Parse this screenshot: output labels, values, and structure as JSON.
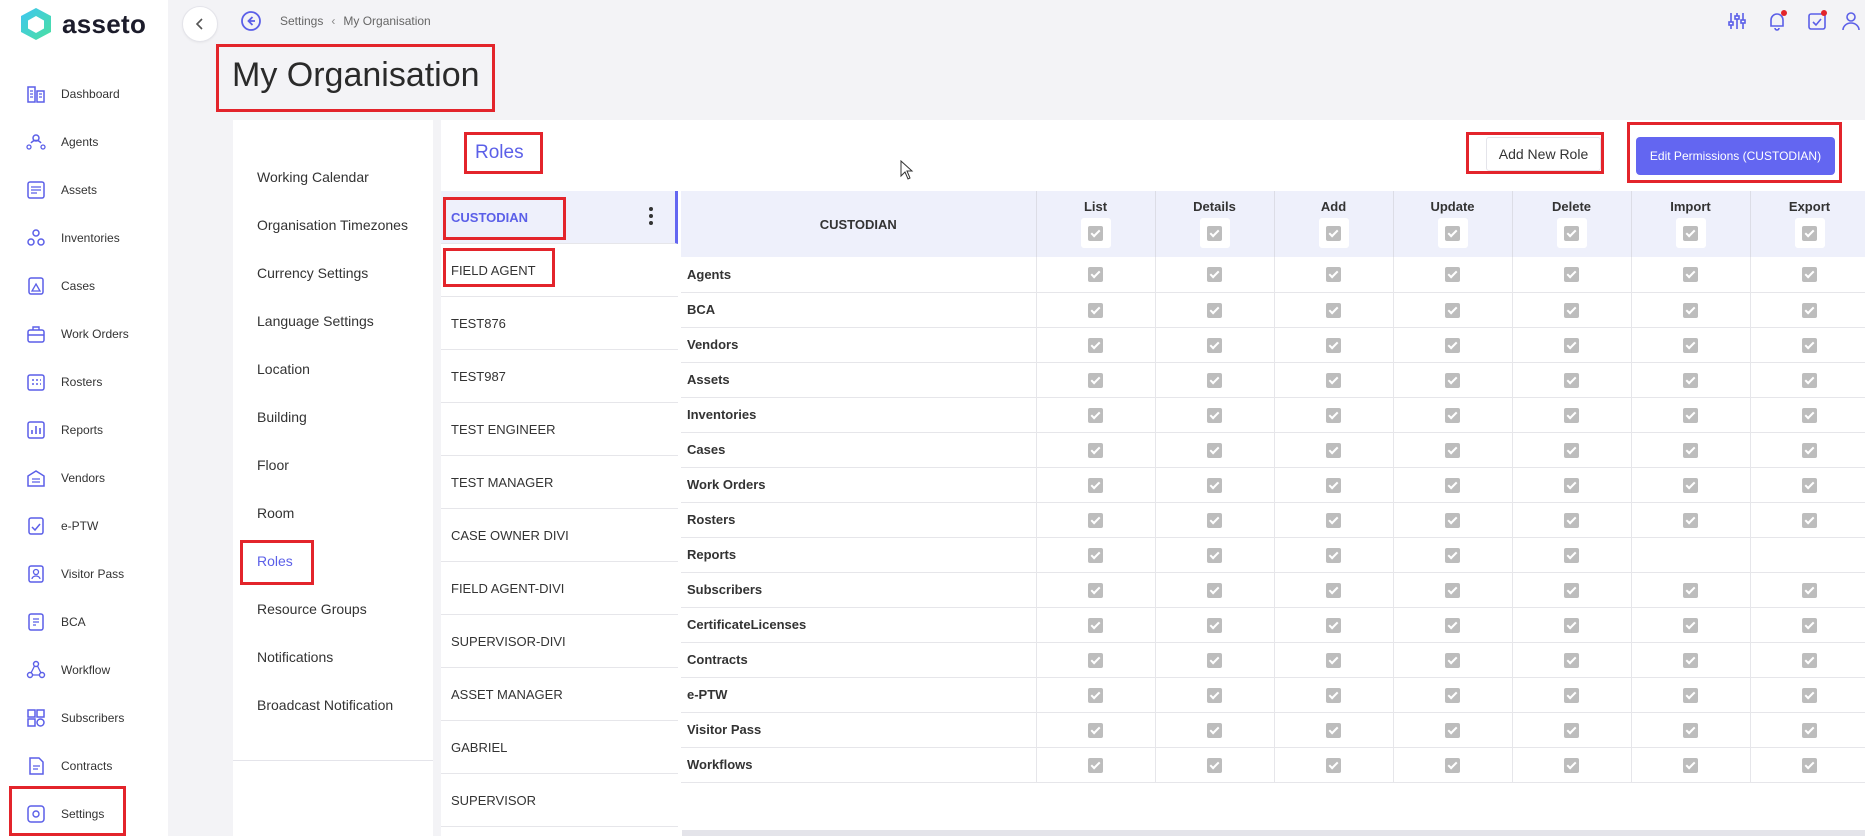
{
  "app": {
    "name": "asseto"
  },
  "breadcrumb": {
    "parent": "Settings",
    "current": "My Organisation"
  },
  "page": {
    "title": "My Organisation"
  },
  "sidebar": {
    "items": [
      {
        "label": "Dashboard",
        "icon": "dashboard-icon"
      },
      {
        "label": "Agents",
        "icon": "agents-icon"
      },
      {
        "label": "Assets",
        "icon": "assets-icon"
      },
      {
        "label": "Inventories",
        "icon": "inventories-icon"
      },
      {
        "label": "Cases",
        "icon": "cases-icon"
      },
      {
        "label": "Work Orders",
        "icon": "work-orders-icon"
      },
      {
        "label": "Rosters",
        "icon": "rosters-icon"
      },
      {
        "label": "Reports",
        "icon": "reports-icon"
      },
      {
        "label": "Vendors",
        "icon": "vendors-icon"
      },
      {
        "label": "e-PTW",
        "icon": "eptw-icon"
      },
      {
        "label": "Visitor Pass",
        "icon": "visitor-pass-icon"
      },
      {
        "label": "BCA",
        "icon": "bca-icon"
      },
      {
        "label": "Workflow",
        "icon": "workflow-icon"
      },
      {
        "label": "Subscribers",
        "icon": "subscribers-icon"
      },
      {
        "label": "Contracts",
        "icon": "contracts-icon"
      },
      {
        "label": "Settings",
        "icon": "settings-icon",
        "active": true
      }
    ]
  },
  "settings_menu": {
    "items": [
      {
        "label": "Working Calendar"
      },
      {
        "label": "Organisation Timezones"
      },
      {
        "label": "Currency Settings"
      },
      {
        "label": "Language Settings"
      },
      {
        "label": "Location"
      },
      {
        "label": "Building"
      },
      {
        "label": "Floor"
      },
      {
        "label": "Room"
      },
      {
        "label": "Roles",
        "active": true
      },
      {
        "label": "Resource Groups"
      },
      {
        "label": "Notifications"
      },
      {
        "label": "Broadcast Notification"
      }
    ]
  },
  "roles": {
    "title": "Roles",
    "add_button": "Add New Role",
    "edit_button": "Edit Permissions (CUSTODIAN)",
    "list": [
      "CUSTODIAN",
      "FIELD AGENT",
      "TEST876",
      "TEST987",
      "TEST ENGINEER",
      "TEST MANAGER",
      "CASE OWNER DIVI",
      "FIELD AGENT-DIVI",
      "SUPERVISOR-DIVI",
      "ASSET MANAGER",
      "GABRIEL",
      "SUPERVISOR"
    ],
    "selected": "CUSTODIAN"
  },
  "permissions": {
    "role_header": "CUSTODIAN",
    "columns": [
      "List",
      "Details",
      "Add",
      "Update",
      "Delete",
      "Import",
      "Export"
    ],
    "rows": [
      {
        "module": "Agents",
        "checks": [
          true,
          true,
          true,
          true,
          true,
          true,
          true
        ]
      },
      {
        "module": "BCA",
        "checks": [
          true,
          true,
          true,
          true,
          true,
          true,
          true
        ]
      },
      {
        "module": "Vendors",
        "checks": [
          true,
          true,
          true,
          true,
          true,
          true,
          true
        ]
      },
      {
        "module": "Assets",
        "checks": [
          true,
          true,
          true,
          true,
          true,
          true,
          true
        ]
      },
      {
        "module": "Inventories",
        "checks": [
          true,
          true,
          true,
          true,
          true,
          true,
          true
        ]
      },
      {
        "module": "Cases",
        "checks": [
          true,
          true,
          true,
          true,
          true,
          true,
          true
        ]
      },
      {
        "module": "Work Orders",
        "checks": [
          true,
          true,
          true,
          true,
          true,
          true,
          true
        ]
      },
      {
        "module": "Rosters",
        "checks": [
          true,
          true,
          true,
          true,
          true,
          true,
          true
        ]
      },
      {
        "module": "Reports",
        "checks": [
          true,
          true,
          true,
          true,
          true,
          false,
          false
        ]
      },
      {
        "module": "Subscribers",
        "checks": [
          true,
          true,
          true,
          true,
          true,
          true,
          true
        ]
      },
      {
        "module": "CertificateLicenses",
        "checks": [
          true,
          true,
          true,
          true,
          true,
          true,
          true
        ]
      },
      {
        "module": "Contracts",
        "checks": [
          true,
          true,
          true,
          true,
          true,
          true,
          true
        ]
      },
      {
        "module": "e-PTW",
        "checks": [
          true,
          true,
          true,
          true,
          true,
          true,
          true
        ]
      },
      {
        "module": "Visitor Pass",
        "checks": [
          true,
          true,
          true,
          true,
          true,
          true,
          true
        ]
      },
      {
        "module": "Workflows",
        "checks": [
          true,
          true,
          true,
          true,
          true,
          true,
          true
        ]
      }
    ]
  },
  "colors": {
    "accent": "#6366f1",
    "highlight": "#e3242b"
  }
}
